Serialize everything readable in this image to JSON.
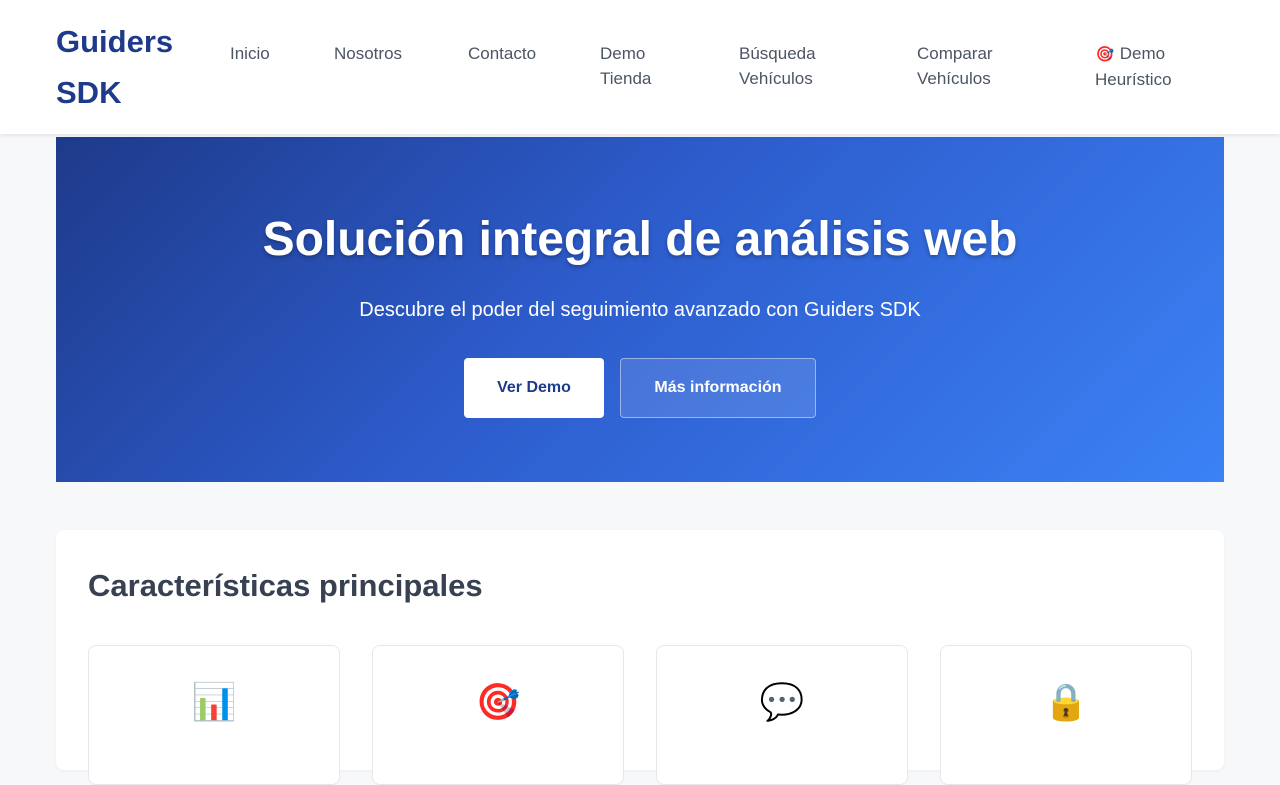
{
  "brand": {
    "name_line1": "Guiders",
    "name_line2": "SDK"
  },
  "nav": {
    "items": [
      {
        "line1": "Inicio",
        "line2": ""
      },
      {
        "line1": "Nosotros",
        "line2": ""
      },
      {
        "line1": "Contacto",
        "line2": ""
      },
      {
        "line1": "Demo",
        "line2": "Tienda"
      },
      {
        "line1": "Búsqueda",
        "line2": "Vehículos"
      },
      {
        "line1": "Comparar",
        "line2": "Vehículos"
      },
      {
        "icon": "🎯",
        "line1": "Demo",
        "line2": "Heurístico"
      }
    ]
  },
  "hero": {
    "title": "Solución integral de análisis web",
    "subtitle": "Descubre el poder del seguimiento avanzado con Guiders SDK",
    "primary_button": "Ver Demo",
    "secondary_button": "Más información"
  },
  "features": {
    "title": "Características principales",
    "cards": [
      {
        "icon": "📊",
        "icon_name": "bar-chart-icon"
      },
      {
        "icon": "🎯",
        "icon_name": "target-icon"
      },
      {
        "icon": "💬",
        "icon_name": "speech-bubble-icon"
      },
      {
        "icon": "🔒",
        "icon_name": "lock-icon"
      }
    ]
  },
  "colors": {
    "brand": "#1e3a8a",
    "hero_gradient_start": "#1e3a8a",
    "hero_gradient_end": "#3b82f6",
    "text": "#374151",
    "background": "#f7f8fa"
  }
}
